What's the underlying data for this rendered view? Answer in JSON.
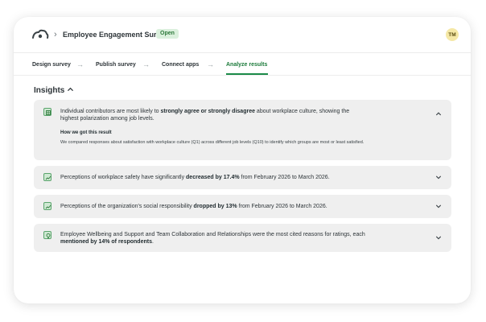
{
  "header": {
    "survey_title": "Employee Engagement Survey",
    "status_badge": "Open",
    "avatar_initials": "TM",
    "brand_icon": "cloud-logo-icon"
  },
  "steps": [
    {
      "label": "Design survey",
      "active": false
    },
    {
      "label": "Publish survey",
      "active": false
    },
    {
      "label": "Connect  apps",
      "active": false
    },
    {
      "label": "Analyze results",
      "active": true
    }
  ],
  "insights": {
    "heading": "Insights",
    "items": [
      {
        "icon": "table-icon",
        "expanded": true,
        "parts": [
          {
            "t": "Individual contributors are most likely to ",
            "b": false
          },
          {
            "t": "strongly agree or strongly disagree",
            "b": true
          },
          {
            "t": " about workplace culture, showing the highest polarization among job levels.",
            "b": false
          }
        ],
        "detail_title": "How we got this result",
        "detail_text": "We compared responses about satisfaction with workplace culture (Q1) across different job levels (Q10) to identify which groups are most or least satisfied."
      },
      {
        "icon": "line-chart-icon",
        "expanded": false,
        "parts": [
          {
            "t": "Perceptions of workplace safety have significantly ",
            "b": false
          },
          {
            "t": "decreased by 17.4%",
            "b": true
          },
          {
            "t": " from February 2026 to March 2026.",
            "b": false
          }
        ]
      },
      {
        "icon": "line-chart-icon",
        "expanded": false,
        "parts": [
          {
            "t": "Perceptions of the organization's social responsibility ",
            "b": false
          },
          {
            "t": "dropped by 13%",
            "b": true
          },
          {
            "t": " from February 2026 to March 2026.",
            "b": false
          }
        ]
      },
      {
        "icon": "lightbulb-icon",
        "expanded": false,
        "parts": [
          {
            "t": "Employee Wellbeing and Support and Team Collaboration and Relationships were the most cited reasons for ratings, each ",
            "b": false
          },
          {
            "t": "mentioned by 14% of respondents",
            "b": true
          },
          {
            "t": ".",
            "b": false
          }
        ]
      }
    ]
  },
  "colors": {
    "accent": "#1b8a48",
    "badge_bg": "#dbf0dd",
    "card_bg": "#efefef"
  }
}
